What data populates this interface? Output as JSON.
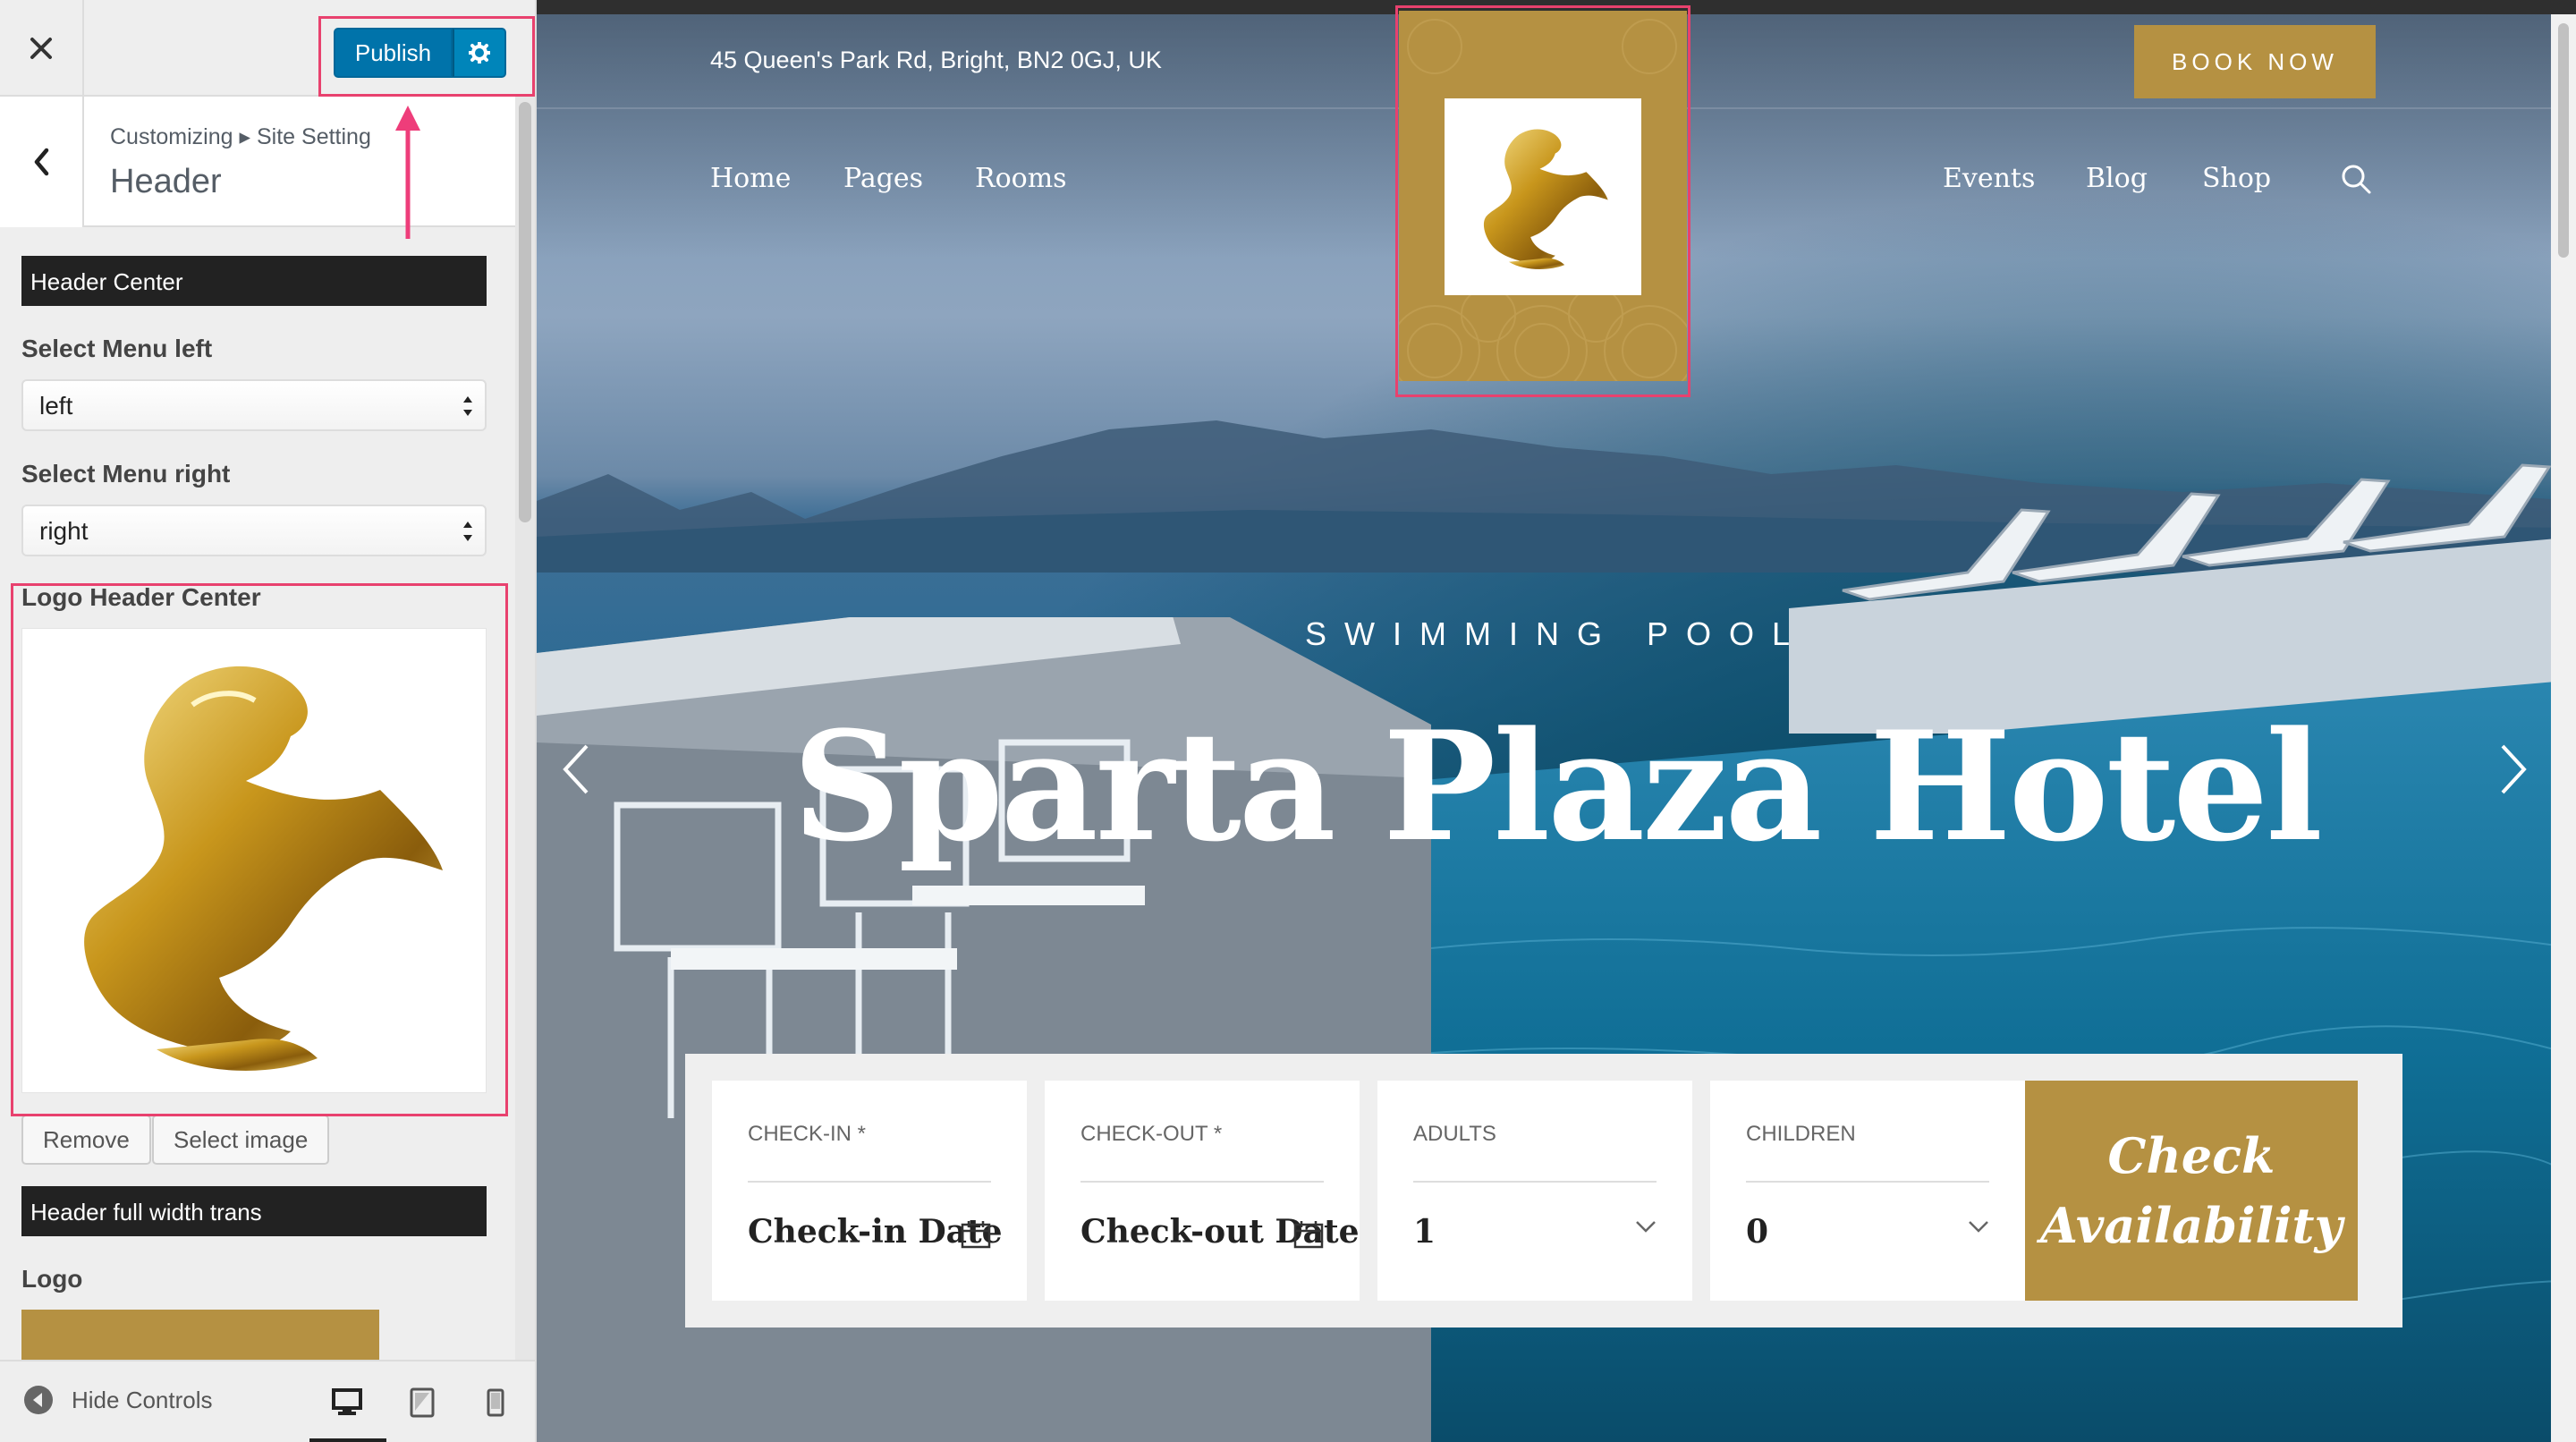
{
  "customizer": {
    "close_icon": "close-icon",
    "publish_label": "Publish",
    "publish_settings_icon": "gear-icon",
    "breadcrumb": "Customizing ▸ Site Setting",
    "section_title": "Header",
    "controls": {
      "header_center_heading": "Header Center",
      "menu_left_label": "Select Menu left",
      "menu_left_value": "left",
      "menu_right_label": "Select Menu right",
      "menu_right_value": "right",
      "logo_center_label": "Logo Header Center",
      "remove_label": "Remove",
      "select_image_label": "Select image",
      "full_width_heading": "Header full width trans",
      "logo_label": "Logo"
    },
    "footer": {
      "hide_controls_label": "Hide Controls",
      "devices": [
        "desktop-icon",
        "tablet-icon",
        "mobile-icon"
      ]
    }
  },
  "site": {
    "address": "45 Queen's Park Rd, Bright, BN2 0GJ, UK",
    "book_now": "BOOK NOW",
    "nav_left": [
      "Home",
      "Pages",
      "Rooms"
    ],
    "nav_right": [
      "Events",
      "Blog",
      "Shop"
    ],
    "hero_kicker": "SWIMMING POOL",
    "hero_title": "Sparta Plaza Hotel",
    "booking": {
      "checkin_label": "CHECK-IN *",
      "checkin_value": "Check-in Date",
      "checkout_label": "CHECK-OUT *",
      "checkout_value": "Check-out Date",
      "adults_label": "ADULTS",
      "adults_value": "1",
      "children_label": "CHILDREN",
      "children_value": "0",
      "submit_line1": "Check",
      "submit_line2": "Availability"
    }
  },
  "colors": {
    "accent_gold": "#b59142",
    "publish_blue": "#0073aa",
    "highlight_pink": "#e8416e"
  }
}
